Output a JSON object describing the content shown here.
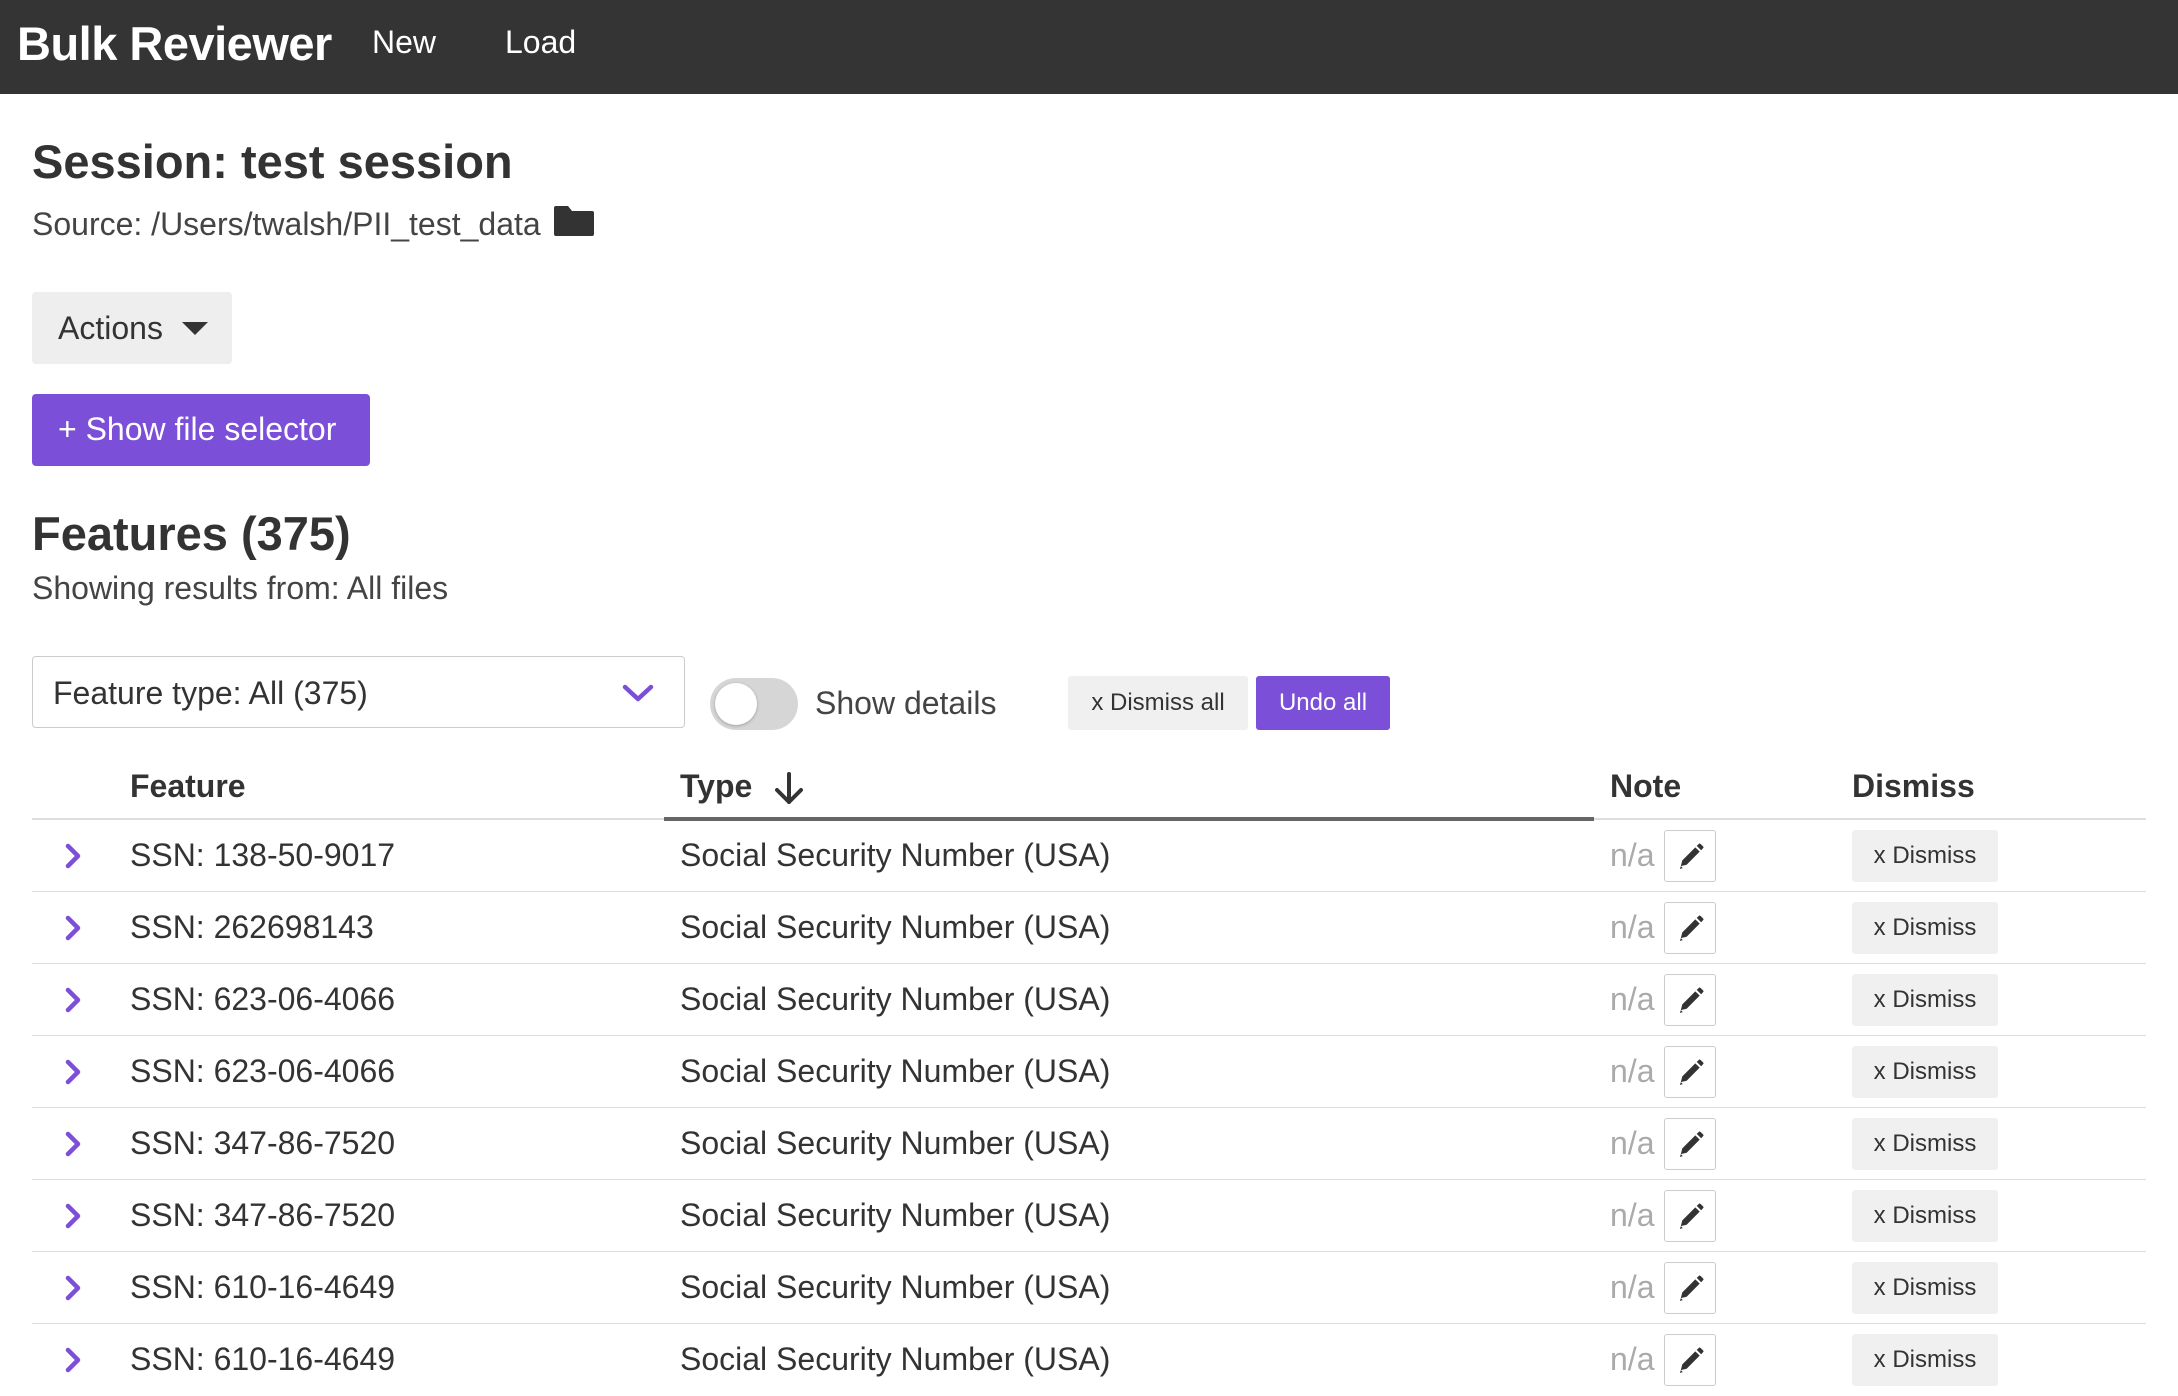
{
  "app": {
    "brand": "Bulk Reviewer",
    "nav": [
      {
        "label": "New"
      },
      {
        "label": "Load"
      }
    ]
  },
  "session": {
    "title": "Session: test session",
    "source": "Source: /Users/twalsh/PII_test_data"
  },
  "actions": {
    "label": "Actions",
    "show_file_selector": "+ Show file selector"
  },
  "features": {
    "title": "Features (375)",
    "showing": "Showing results from: All files",
    "type_filter": "Feature type: All (375)",
    "show_details_label": "Show details",
    "show_details_on": false,
    "dismiss_all": "x Dismiss all",
    "undo_all": "Undo all"
  },
  "table": {
    "columns": {
      "feature": "Feature",
      "type": "Type",
      "note": "Note",
      "dismiss": "Dismiss"
    },
    "rows": [
      {
        "feature": "SSN: 138-50-9017",
        "type": "Social Security Number (USA)",
        "note": "n/a",
        "dismiss": "x Dismiss"
      },
      {
        "feature": "SSN: 262698143",
        "type": "Social Security Number (USA)",
        "note": "n/a",
        "dismiss": "x Dismiss"
      },
      {
        "feature": "SSN: 623-06-4066",
        "type": "Social Security Number (USA)",
        "note": "n/a",
        "dismiss": "x Dismiss"
      },
      {
        "feature": "SSN: 623-06-4066",
        "type": "Social Security Number (USA)",
        "note": "n/a",
        "dismiss": "x Dismiss"
      },
      {
        "feature": "SSN: 347-86-7520",
        "type": "Social Security Number (USA)",
        "note": "n/a",
        "dismiss": "x Dismiss"
      },
      {
        "feature": "SSN: 347-86-7520",
        "type": "Social Security Number (USA)",
        "note": "n/a",
        "dismiss": "x Dismiss"
      },
      {
        "feature": "SSN: 610-16-4649",
        "type": "Social Security Number (USA)",
        "note": "n/a",
        "dismiss": "x Dismiss"
      },
      {
        "feature": "SSN: 610-16-4649",
        "type": "Social Security Number (USA)",
        "note": "n/a",
        "dismiss": "x Dismiss"
      }
    ]
  },
  "icons": {
    "folder": "folder-icon",
    "caret": "caret-down-icon",
    "select": "chevron-down-icon",
    "sort": "arrow-down-icon",
    "expand": "chevron-right-icon",
    "edit": "pencil-icon"
  },
  "colors": {
    "navbar": "#343434",
    "accent": "#7b4fd8",
    "text": "#333333",
    "muted": "#aaaaaa",
    "button_light": "#f0f0f0"
  }
}
